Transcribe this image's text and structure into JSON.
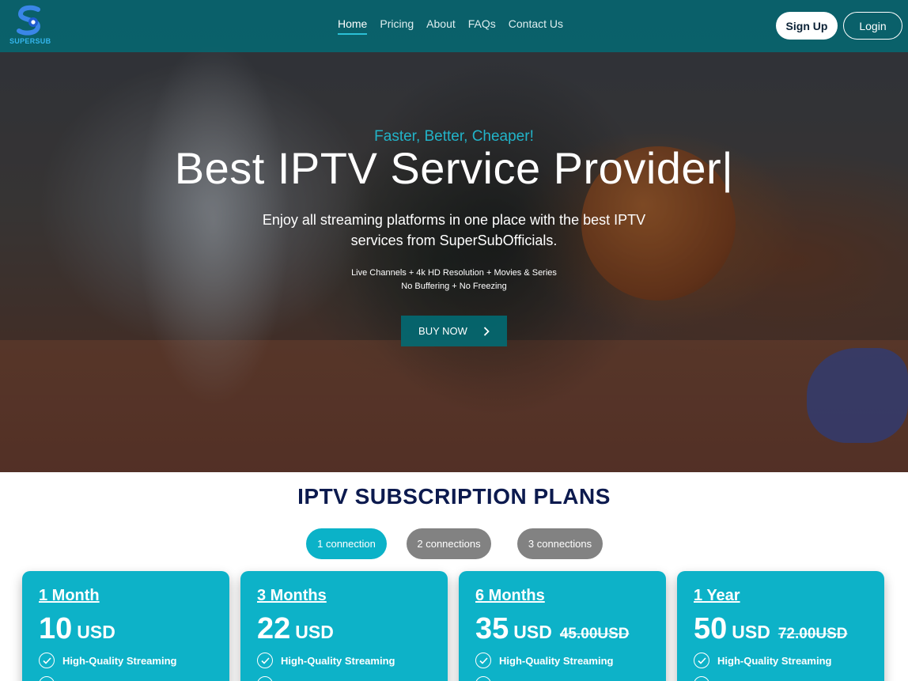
{
  "brand": {
    "name": "SUPERSUB",
    "logo_icon": "s-play-logo-icon",
    "accent": "#0db2c8",
    "nav_bg": "#006e78"
  },
  "nav": {
    "links": [
      {
        "label": "Home",
        "active": true
      },
      {
        "label": "Pricing"
      },
      {
        "label": "About"
      },
      {
        "label": "FAQs"
      },
      {
        "label": "Contact Us"
      }
    ],
    "signup_label": "Sign Up",
    "login_label": "Login"
  },
  "hero": {
    "tagline": "Faster, Better, Cheaper!",
    "headline": "Best IPTV Service Provider|",
    "sub_line1": "Enjoy all streaming platforms in one place with the best IPTV",
    "sub_line2": "services from SuperSubOfficials.",
    "features_line1": "Live Channels + 4k HD Resolution + Movies & Series",
    "features_line2": "No Buffering + No Freezing",
    "cta_label": "BUY NOW",
    "cta_icon": "chevron-right-icon"
  },
  "plans": {
    "title": "IPTV SUBSCRIPTION PLANS",
    "connections": [
      {
        "label": "1 connection",
        "selected": true
      },
      {
        "label": "2 connections"
      },
      {
        "label": "3 connections"
      }
    ],
    "cards": [
      {
        "period": "1 Month",
        "amount": "10",
        "currency": "USD",
        "old_price": "",
        "feature": "High-Quality Streaming"
      },
      {
        "period": "3 Months",
        "amount": "22",
        "currency": "USD",
        "old_price": "",
        "feature": "High-Quality Streaming"
      },
      {
        "period": "6 Months",
        "amount": "35",
        "currency": "USD",
        "old_price": "45.00USD",
        "feature": "High-Quality Streaming"
      },
      {
        "period": "1 Year",
        "amount": "50",
        "currency": "USD",
        "old_price": "72.00USD",
        "feature": "High-Quality Streaming"
      }
    ]
  }
}
